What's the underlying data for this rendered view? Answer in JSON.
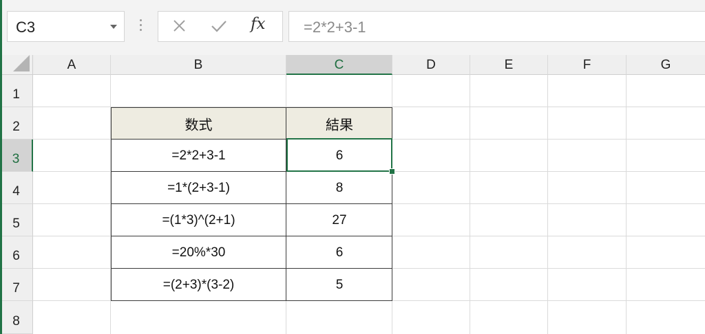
{
  "namebox": {
    "value": "C3"
  },
  "formula_bar": {
    "cancel_icon": "close-icon",
    "enter_icon": "check-icon",
    "function_label": "fx",
    "formula": "=2*2+3-1"
  },
  "columns": [
    "A",
    "B",
    "C",
    "D",
    "E",
    "F",
    "G"
  ],
  "rows": [
    "1",
    "2",
    "3",
    "4",
    "5",
    "6",
    "7",
    "8"
  ],
  "active_cell": {
    "column": "C",
    "row": "3"
  },
  "table": {
    "headers": [
      "数式",
      "結果"
    ],
    "rows": [
      [
        "=2*2+3-1",
        "6"
      ],
      [
        "=1*(2+3-1)",
        "8"
      ],
      [
        "=(1*3)^(2+1)",
        "27"
      ],
      [
        "=20%*30",
        "6"
      ],
      [
        "=(2+3)*(3-2)",
        "5"
      ]
    ]
  },
  "colors": {
    "accent": "#217346",
    "table_header_fill": "#eeece1"
  }
}
